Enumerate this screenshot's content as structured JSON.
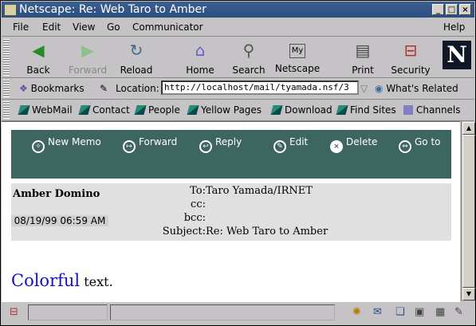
{
  "window": {
    "title": "Netscape: Re: Web Taro to Amber"
  },
  "menu": [
    "File",
    "Edit",
    "View",
    "Go",
    "Communicator",
    "Help"
  ],
  "nav": {
    "back": "Back",
    "forward": "Forward",
    "reload": "Reload",
    "home": "Home",
    "search": "Search",
    "netscape": "Netscape",
    "print": "Print",
    "security": "Security",
    "logo": "N"
  },
  "location": {
    "bookmarks": "Bookmarks",
    "label": "Location:",
    "url": "http://localhost/mail/tyamada.nsf/3",
    "whats_related": "What's Related"
  },
  "personal": [
    "WebMail",
    "Contact",
    "People",
    "Yellow Pages",
    "Download",
    "Find Sites",
    "Channels"
  ],
  "actions": [
    "New Memo",
    "Forward",
    "Reply",
    "Edit",
    "Delete",
    "Go to"
  ],
  "memo": {
    "author": "Amber Domino",
    "date": "08/19/99 06:59 AM",
    "to_label": "To:",
    "to": "Taro Yamada/IRNET",
    "cc_label": "cc:",
    "cc": "",
    "bcc_label": "bcc:",
    "bcc": "",
    "subject_label": "Subject:",
    "subject": "Re: Web Taro to Amber"
  },
  "body": {
    "colored_word": "Colorful",
    "rest": " text.",
    "colored_word_color": "#1010d0"
  },
  "colors": {
    "action_bar": "#3d6660",
    "title_bar": "#2c4f80"
  }
}
